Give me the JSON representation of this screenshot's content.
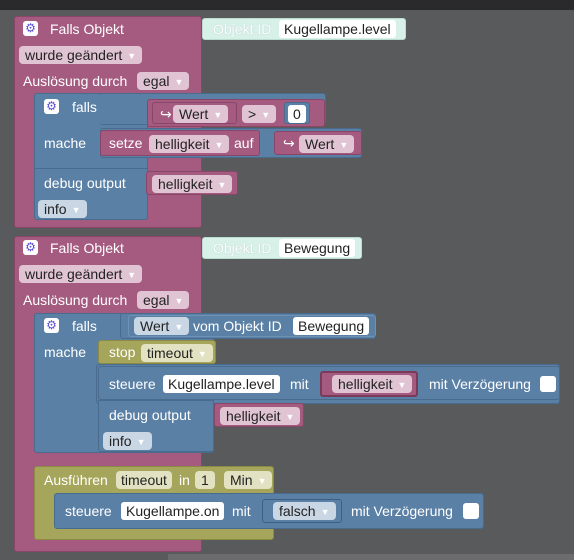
{
  "block1": {
    "falls_objekt": "Falls Objekt",
    "objekt_id_label": "Objekt ID",
    "objekt_id_value": "Kugellampe.level",
    "trigger": "wurde geändert",
    "ausloesung": "Auslösung durch",
    "ausloesung_value": "egal",
    "if_label": "falls",
    "var_wert": "Wert",
    "operator": ">",
    "number": "0",
    "mache": "mache",
    "setze": "setze",
    "var_helligkeit": "helligkeit",
    "auf": "auf",
    "var_wert2": "Wert",
    "debug_label": "debug output",
    "debug_var": "helligkeit",
    "debug_level": "info"
  },
  "block2": {
    "falls_objekt": "Falls Objekt",
    "objekt_id_label": "Objekt ID",
    "objekt_id_value": "Bewegung",
    "trigger": "wurde geändert",
    "ausloesung": "Auslösung durch",
    "ausloesung_value": "egal",
    "if_label": "falls",
    "wert": "Wert",
    "vom_objekt": "vom Objekt ID",
    "vom_objekt_value": "Bewegung",
    "mache": "mache",
    "stop": "stop",
    "timeout": "timeout",
    "steuere": "steuere",
    "steuere_target": "Kugellampe.level",
    "mit": "mit",
    "steuere_var": "helligkeit",
    "mit_verz": "mit Verzögerung",
    "debug_label": "debug output",
    "debug_var": "helligkeit",
    "debug_level": "info",
    "ausfuehren": "Ausführen",
    "ausf_timeout": "timeout",
    "in": "in",
    "in_value": "1",
    "unit": "Min",
    "steuere2": "steuere",
    "steuere2_target": "Kugellampe.on",
    "mit2": "mit",
    "falsch": "falsch",
    "mit_verz2": "mit Verzögerung"
  },
  "icons": {
    "settings": "gear-icon",
    "variable_arrow": "↪",
    "dropdown": "▾"
  },
  "colors": {
    "event_block": "#a55b80",
    "logic_block": "#5b80a5",
    "timeout_block": "#a5a55b",
    "objekt_id_block": "#d8f1e8",
    "workspace": "#595a5c"
  }
}
